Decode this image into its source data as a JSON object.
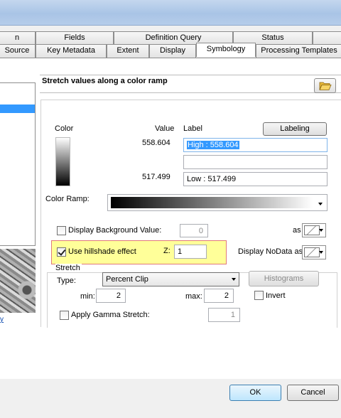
{
  "tabs_row1": [
    {
      "label": "n"
    },
    {
      "label": "Fields"
    },
    {
      "label": "Definition Query"
    },
    {
      "label": "Status"
    },
    {
      "label": ""
    }
  ],
  "tabs_row2": [
    {
      "label": "Source"
    },
    {
      "label": "Key Metadata"
    },
    {
      "label": "Extent"
    },
    {
      "label": "Display"
    },
    {
      "label": "Symbology",
      "selected": true
    },
    {
      "label": "Processing Templates"
    }
  ],
  "left": {
    "link": "y"
  },
  "heading": "Stretch values along a color ramp",
  "columns": {
    "color": "Color",
    "value": "Value",
    "label": "Label"
  },
  "labeling_button": "Labeling",
  "high": {
    "value": "558.604",
    "label": "High : 558.604"
  },
  "middle": {
    "label": ""
  },
  "low": {
    "value": "517.499",
    "label": "Low : 517.499"
  },
  "color_ramp_label": "Color Ramp:",
  "background": {
    "label": "Display Background Value:",
    "value": "0",
    "as_label": "as",
    "checked": false
  },
  "hillshade": {
    "label": "Use hillshade effect",
    "z_label": "Z:",
    "z_value": "1",
    "checked": true
  },
  "nodata": {
    "label": "Display NoData as"
  },
  "stretch": {
    "group_label": "Stretch",
    "type_label": "Type:",
    "type_value": "Percent Clip",
    "histograms_button": "Histograms",
    "min_label": "min:",
    "min_value": "2",
    "max_label": "max:",
    "max_value": "2",
    "invert_label": "Invert",
    "invert_checked": false
  },
  "gamma": {
    "label": "Apply Gamma Stretch:",
    "value": "1",
    "checked": false
  },
  "ok_button": "OK",
  "cancel_button": "Cancel",
  "colors": {
    "selection": "#3399ff",
    "highlight": "#ffff99",
    "highlight_border": "#e07a7a"
  }
}
